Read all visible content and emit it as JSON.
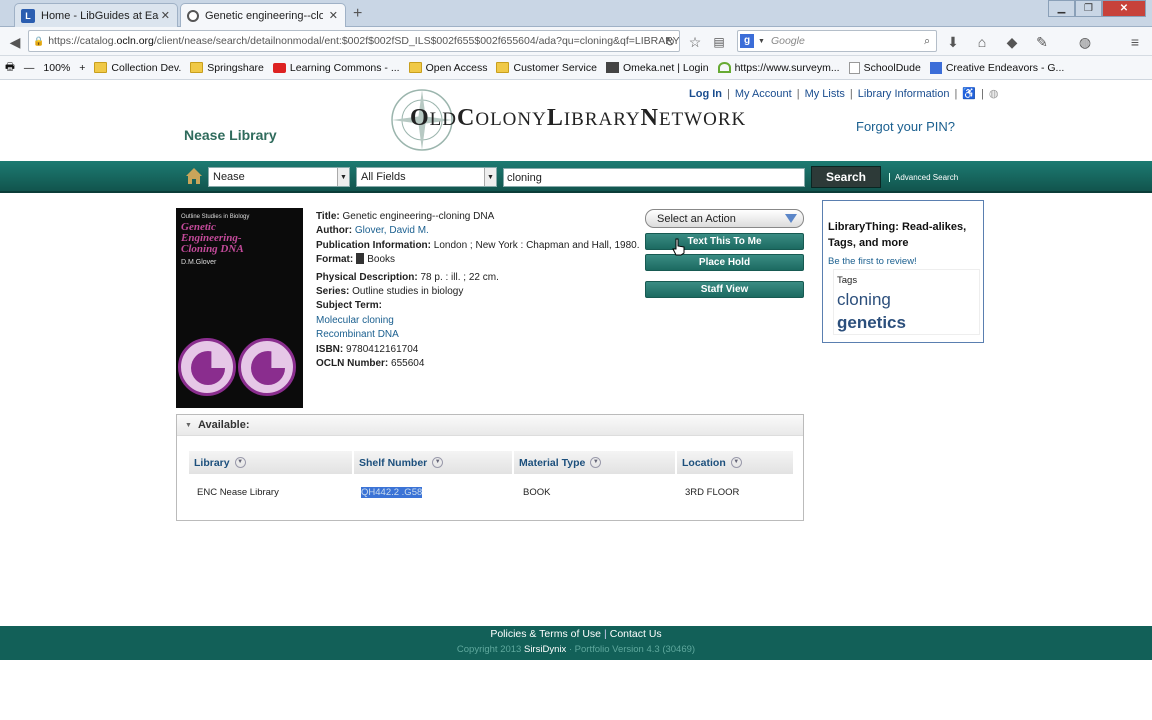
{
  "browser": {
    "tabs": [
      {
        "title": "Home - LibGuides at Easter...",
        "active": false
      },
      {
        "title": "Genetic engineering--cloni...",
        "active": true
      }
    ],
    "url_prefix": "https://catalog.",
    "url_host": "ocln.org",
    "url_rest": "/client/nease/search/detailnonmodal/ent:$002f$002fSD_ILS$002f655$002f655604/ada?qu=cloning&qf=LIBRARY",
    "search_placeholder": "Google",
    "zoom": "100%",
    "bookmarks": [
      "Collection Dev.",
      "Springshare",
      "Learning Commons - ...",
      "Open Access",
      "Customer Service",
      "Omeka.net | Login",
      "https://www.surveym...",
      "SchoolDude",
      "Creative Endeavors - G..."
    ]
  },
  "header": {
    "library_name": "Nease Library",
    "network_name": "Old Colony Library Network",
    "net_O": "O",
    "net_ld": "LD",
    "net_C": "C",
    "net_olony": "OLONY",
    "net_L": "L",
    "net_ibrary": "IBRARY",
    "net_N": "N",
    "net_etwork": "ETWORK",
    "links": {
      "login": "Log In",
      "account": "My Account",
      "lists": "My Lists",
      "info": "Library Information"
    },
    "forgot_pin": "Forgot your PIN?"
  },
  "search": {
    "library_select": "Nease",
    "field_select": "All Fields",
    "query": "cloning",
    "button": "Search",
    "advanced": "Advanced Search"
  },
  "cover": {
    "series": "Outline Studies in Biology",
    "title_line1": "Genetic",
    "title_line2": "Engineering-",
    "title_line3": "Cloning DNA",
    "author": "D.M.Glover"
  },
  "record": {
    "title_label": "Title:",
    "title": "Genetic engineering--cloning DNA",
    "author_label": "Author:",
    "author": "Glover, David M.",
    "pub_label": "Publication Information:",
    "pub": "London ; New York : Chapman and Hall, 1980.",
    "format_label": "Format:",
    "format": "Books",
    "phys_label": "Physical Description:",
    "phys": "78 p. : ill. ; 22 cm.",
    "series_label": "Series:",
    "series": "Outline studies in biology",
    "subject_label": "Subject Term:",
    "subjects": [
      "Molecular cloning",
      "Recombinant DNA"
    ],
    "isbn_label": "ISBN:",
    "isbn": "9780412161704",
    "ocln_label": "OCLN Number:",
    "ocln": "655604"
  },
  "actions": {
    "select": "Select an Action",
    "text_me": "Text This To Me",
    "hold": "Place Hold",
    "staff": "Staff View"
  },
  "librarything": {
    "heading": "LibraryThing: Read-alikes, Tags, and more",
    "review": "Be the first to review!",
    "tags_label": "Tags",
    "tags": [
      "cloning",
      "genetics"
    ]
  },
  "availability": {
    "heading": "Available:",
    "columns": [
      "Library",
      "Shelf Number",
      "Material Type",
      "Location"
    ],
    "rows": [
      {
        "library": "ENC Nease Library",
        "shelf": "QH442.2 .G58",
        "type": "BOOK",
        "location": "3RD FLOOR"
      }
    ]
  },
  "footer": {
    "policies": "Policies & Terms of Use",
    "contact": "Contact Us",
    "copy_pre": "Copyright 2013",
    "copy_brand": "SirsiDynix",
    "copy_post": "· Portfolio Version 4.3 (30469)"
  },
  "colors": {
    "accent": "#126058",
    "link": "#1a5f8f",
    "selection": "#3b73d6"
  }
}
